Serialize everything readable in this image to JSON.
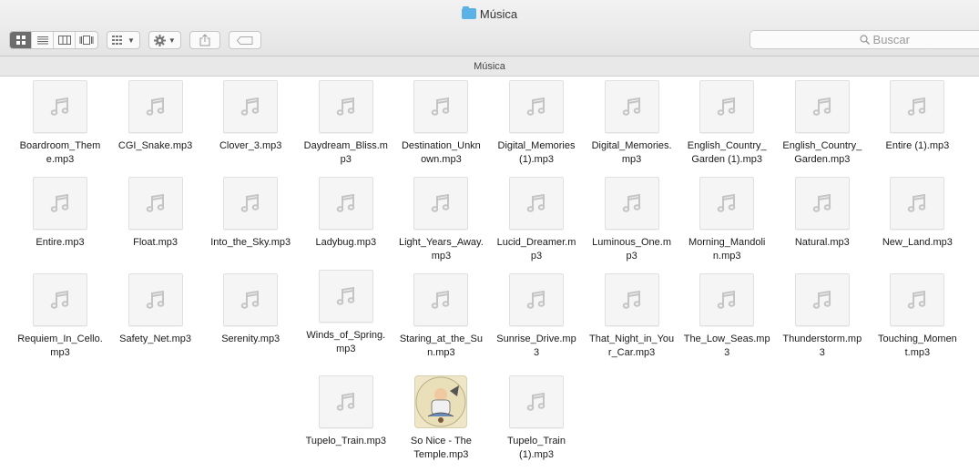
{
  "window": {
    "title": "Música"
  },
  "toolbar": {
    "view_buttons": [
      "icon-view-icon",
      "list-view-icon",
      "column-view-icon",
      "cover-flow-icon"
    ],
    "arrange_icon": "arrange-icon",
    "action_icon": "gear-icon",
    "share_icon": "share-icon",
    "tag_icon": "tag-icon"
  },
  "search": {
    "placeholder": "Buscar"
  },
  "pathbar": {
    "label": "Música"
  },
  "files": [
    {
      "name": "Boardroom_Theme.mp3",
      "display": "Boardroom_Them\ne.mp3"
    },
    {
      "name": "CGI_Snake.mp3",
      "display": "CGI_Snake.mp3"
    },
    {
      "name": "Clover_3.mp3",
      "display": "Clover_3.mp3"
    },
    {
      "name": "Daydream_Bliss.mp3",
      "display": "Daydream_Bliss.m\np3"
    },
    {
      "name": "Destination_Unknown.mp3",
      "display": "Destination_Unkn\nown.mp3"
    },
    {
      "name": "Digital_Memories (1).mp3",
      "display": "Digital_Memories\n(1).mp3"
    },
    {
      "name": "Digital_Memories.mp3",
      "display": "Digital_Memories.\nmp3"
    },
    {
      "name": "English_Country_Garden (1).mp3",
      "display": "English_Country_\nGarden (1).mp3"
    },
    {
      "name": "English_Country_Garden.mp3",
      "display": "English_Country_\nGarden.mp3"
    },
    {
      "name": "Entire (1).mp3",
      "display": "Entire (1).mp3"
    },
    {
      "name": "Entire.mp3",
      "display": "Entire.mp3"
    },
    {
      "name": "Float.mp3",
      "display": "Float.mp3"
    },
    {
      "name": "Into_the_Sky.mp3",
      "display": "Into_the_Sky.mp3"
    },
    {
      "name": "Ladybug.mp3",
      "display": "Ladybug.mp3"
    },
    {
      "name": "Light_Years_Away.mp3",
      "display": "Light_Years_Away.\nmp3"
    },
    {
      "name": "Lucid_Dreamer.mp3",
      "display": "Lucid_Dreamer.m\np3"
    },
    {
      "name": "Luminous_One.mp3",
      "display": "Luminous_One.m\np3"
    },
    {
      "name": "Morning_Mandolin.mp3",
      "display": "Morning_Mandoli\nn.mp3"
    },
    {
      "name": "Natural.mp3",
      "display": "Natural.mp3"
    },
    {
      "name": "New_Land.mp3",
      "display": "New_Land.mp3"
    },
    {
      "name": "Requiem_In_Cello.mp3",
      "display": "Requiem_In_Cello.\nmp3"
    },
    {
      "name": "Safety_Net.mp3",
      "display": "Safety_Net.mp3"
    },
    {
      "name": "Serenity.mp3",
      "display": "Serenity.mp3"
    },
    {
      "name": "Winds_of_Spring.mp3",
      "display": "Winds_of_Spring.\nmp3"
    },
    {
      "name": "Staring_at_the_Sun.mp3",
      "display": "Staring_at_the_Su\nn.mp3"
    },
    {
      "name": "Sunrise_Drive.mp3",
      "display": "Sunrise_Drive.mp\n3"
    },
    {
      "name": "That_Night_in_Your_Car.mp3",
      "display": "That_Night_in_You\nr_Car.mp3"
    },
    {
      "name": "The_Low_Seas.mp3",
      "display": "The_Low_Seas.mp\n3"
    },
    {
      "name": "Thunderstorm.mp3",
      "display": "Thunderstorm.mp\n3"
    },
    {
      "name": "Touching_Moment.mp3",
      "display": "Touching_Momen\nt.mp3"
    },
    {
      "name": "Tupelo_Train.mp3",
      "display": "Tupelo_Train.mp3"
    },
    {
      "name": "So Nice - The Temple.mp3",
      "display": "So Nice - The\nTemple.mp3",
      "artwork": true
    },
    {
      "name": "Tupelo_Train (1).mp3",
      "display": "Tupelo_Train\n(1).mp3"
    }
  ]
}
